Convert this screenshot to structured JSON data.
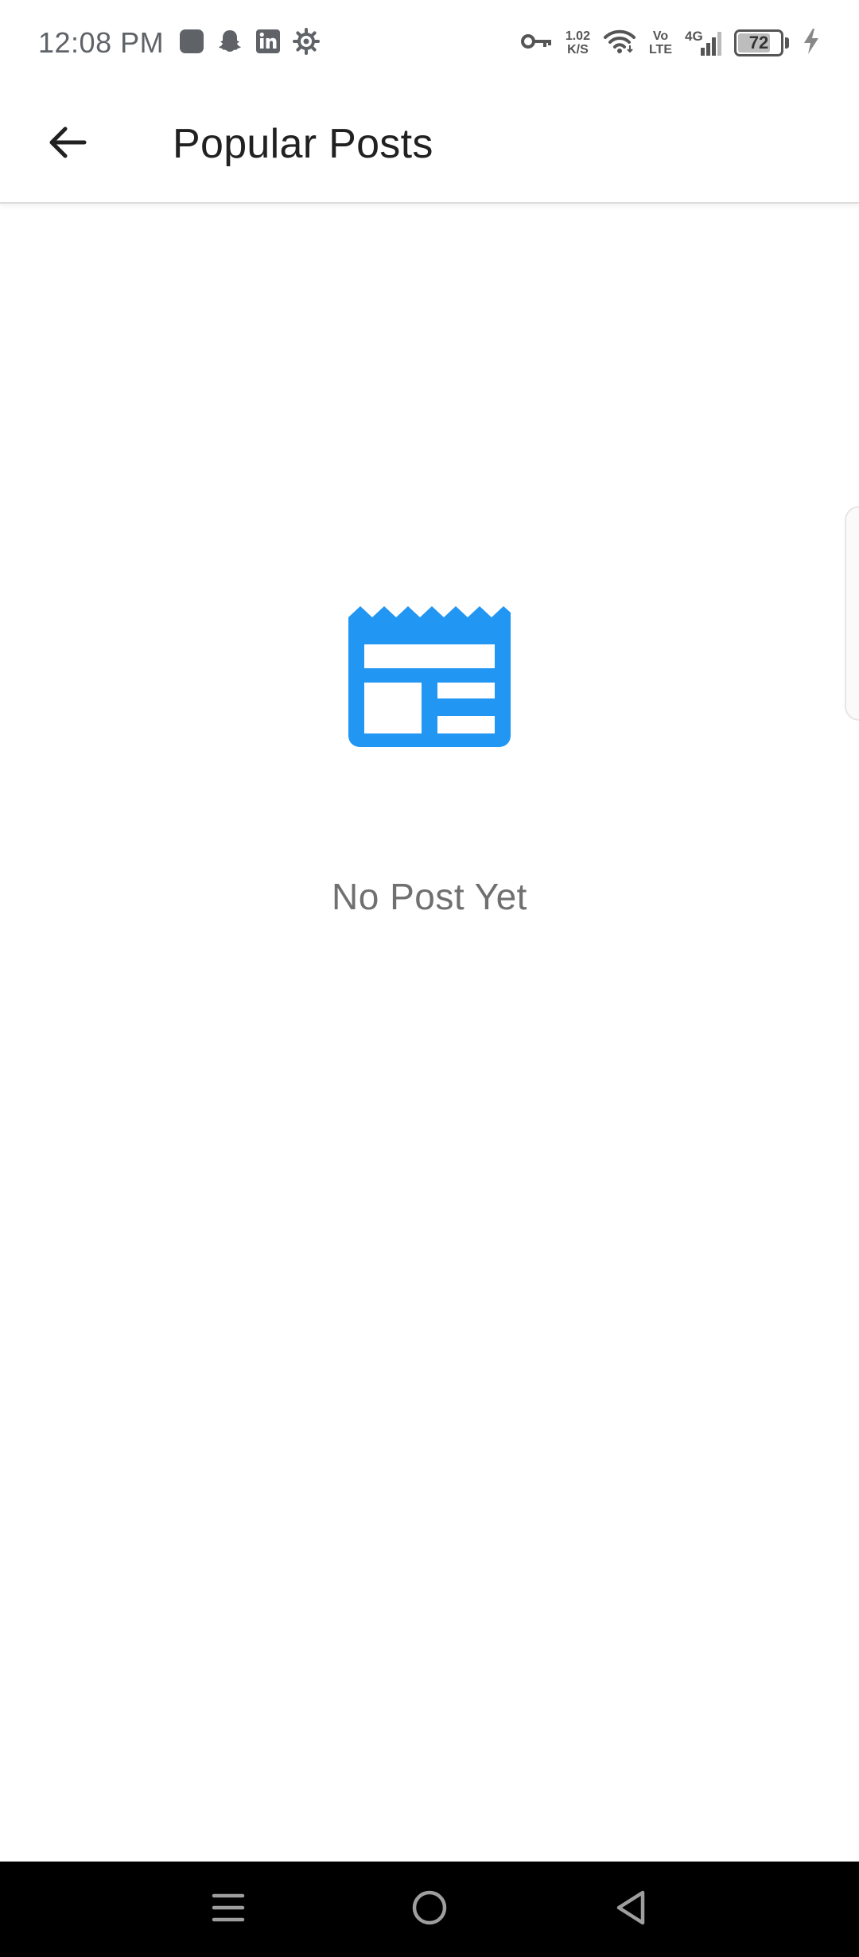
{
  "status_bar": {
    "time": "12:08 PM",
    "net_speed_value": "1.02",
    "net_speed_unit": "K/S",
    "volte_top": "Vo",
    "volte_bottom": "LTE",
    "network_type": "4G",
    "battery_level": "72",
    "icons_left": [
      "app-square-icon",
      "snapchat-icon",
      "linkedin-icon",
      "gear-icon"
    ],
    "icons_right": [
      "vpn-key-icon",
      "wifi-icon",
      "signal-icon",
      "battery-icon",
      "charging-icon"
    ]
  },
  "app_bar": {
    "title": "Popular Posts",
    "back_icon": "arrow-back-icon"
  },
  "empty_state": {
    "message": "No Post Yet",
    "icon": "newspaper-icon",
    "icon_color": "#2196f3"
  },
  "nav_bar": {
    "buttons": [
      "menu-icon",
      "home-icon",
      "back-triangle-icon"
    ]
  }
}
